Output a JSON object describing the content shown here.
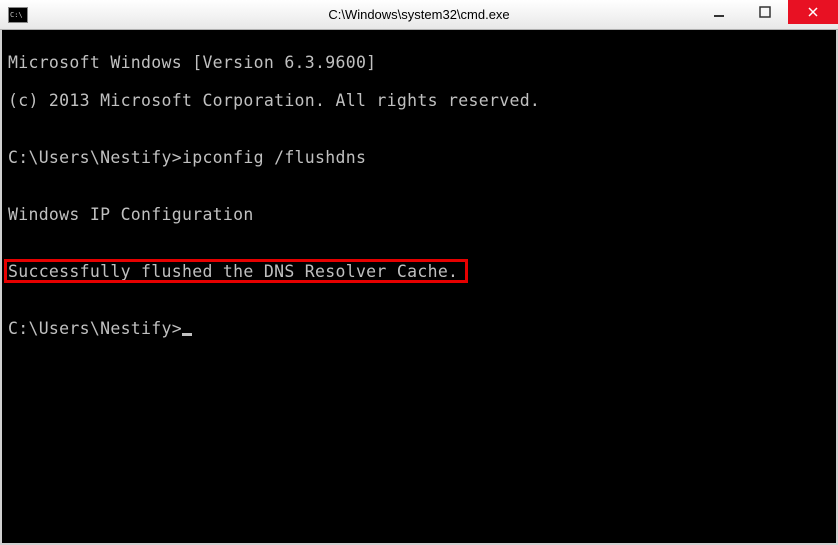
{
  "titlebar": {
    "icon_label": "C:\\",
    "title": "C:\\Windows\\system32\\cmd.exe"
  },
  "terminal": {
    "line1": "Microsoft Windows [Version 6.3.9600]",
    "line2": "(c) 2013 Microsoft Corporation. All rights reserved.",
    "blank1": "",
    "prompt1_path": "C:\\Users\\Nestify>",
    "prompt1_cmd": "ipconfig /flushdns",
    "blank2": "",
    "heading": "Windows IP Configuration",
    "blank3": "",
    "success_msg": "Successfully flushed the DNS Resolver Cache.",
    "blank4": "",
    "prompt2_path": "C:\\Users\\Nestify>"
  }
}
